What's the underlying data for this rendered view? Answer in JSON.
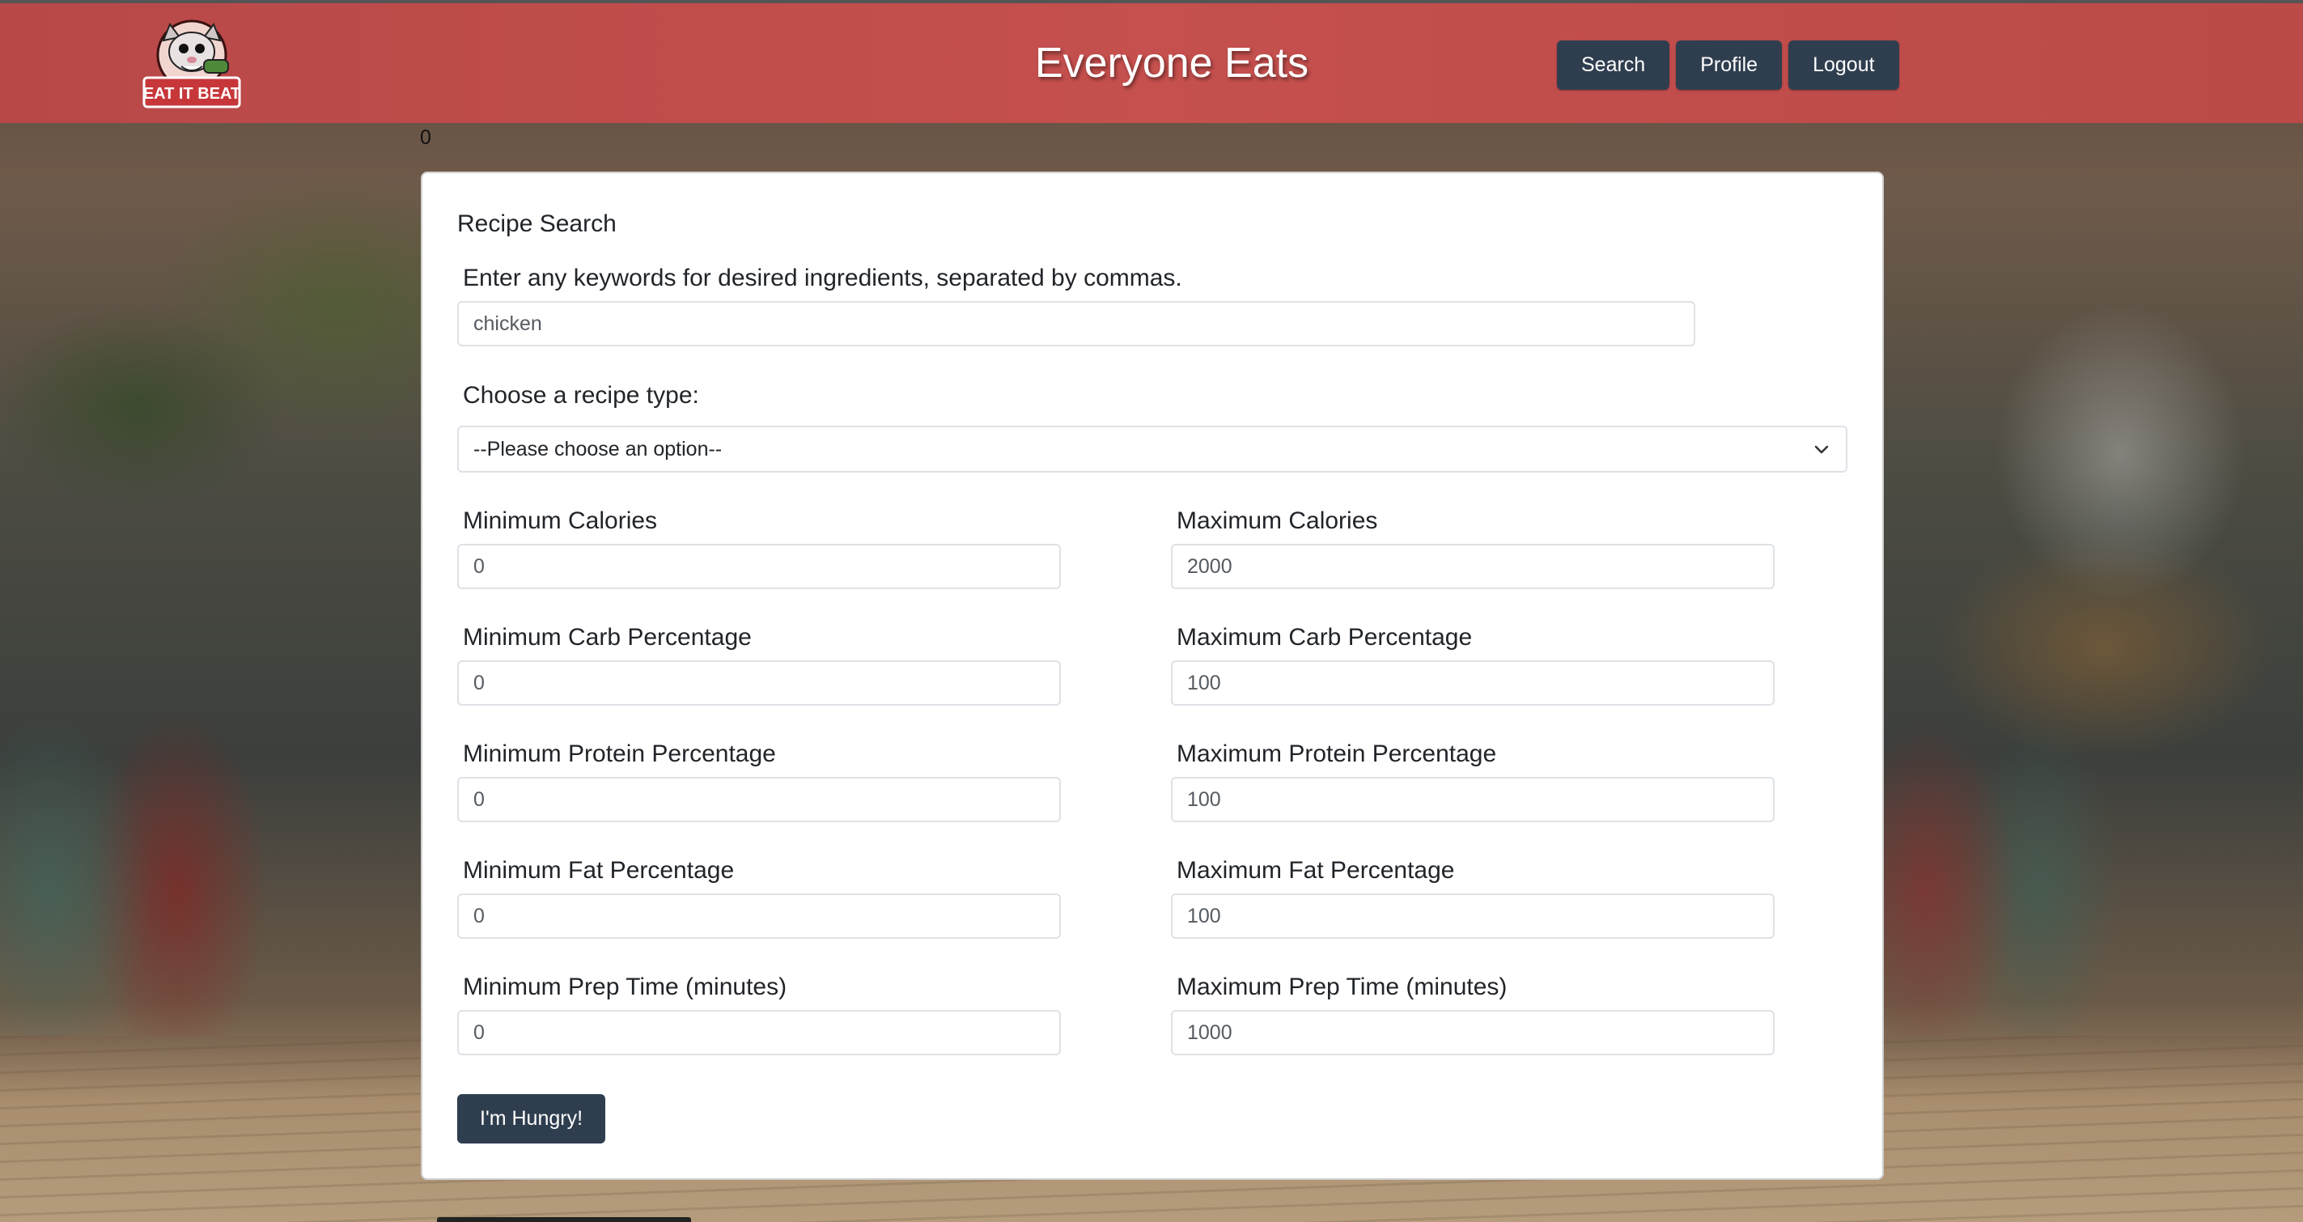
{
  "header": {
    "title": "Everyone Eats",
    "logo_text": "EAT IT BEAT",
    "nav": {
      "search": "Search",
      "profile": "Profile",
      "logout": "Logout"
    }
  },
  "counter": "0",
  "form": {
    "title": "Recipe Search",
    "keywords": {
      "label": "Enter any keywords for desired ingredients, separated by commas.",
      "value": "chicken"
    },
    "recipe_type": {
      "label": "Choose a recipe type:",
      "selected": "--Please choose an option--"
    },
    "min_calories": {
      "label": "Minimum Calories",
      "value": "0"
    },
    "max_calories": {
      "label": "Maximum Calories",
      "value": "2000"
    },
    "min_carb": {
      "label": "Minimum Carb Percentage",
      "value": "0"
    },
    "max_carb": {
      "label": "Maximum Carb Percentage",
      "value": "100"
    },
    "min_protein": {
      "label": "Minimum Protein Percentage",
      "value": "0"
    },
    "max_protein": {
      "label": "Maximum Protein Percentage",
      "value": "100"
    },
    "min_fat": {
      "label": "Minimum Fat Percentage",
      "value": "0"
    },
    "max_fat": {
      "label": "Maximum Fat Percentage",
      "value": "100"
    },
    "min_prep": {
      "label": "Minimum Prep Time (minutes)",
      "value": "0"
    },
    "max_prep": {
      "label": "Maximum Prep Time (minutes)",
      "value": "1000"
    },
    "submit": "I'm Hungry!"
  },
  "colors": {
    "header_bg": "#c5504e",
    "button_bg": "#2f3e4f",
    "card_bg": "#ffffff"
  },
  "icons": {
    "logo": "opossum-mascot-logo",
    "select": "chevron-down-icon"
  }
}
